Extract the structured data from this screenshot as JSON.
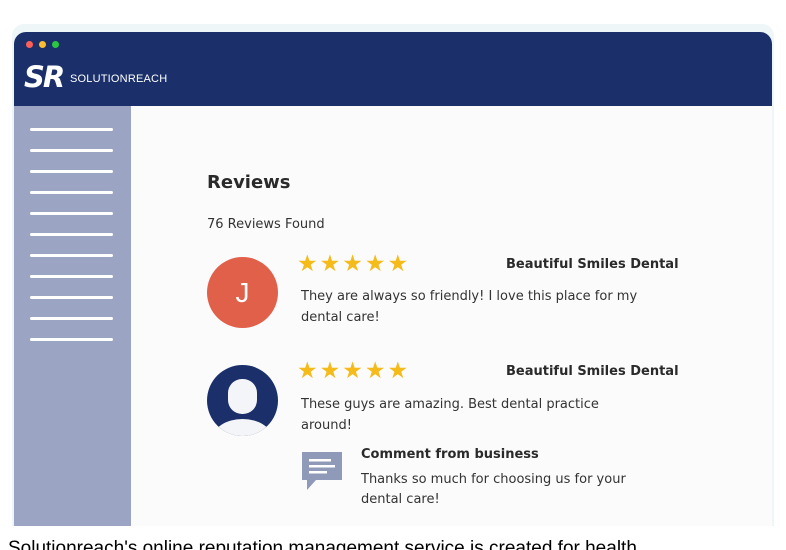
{
  "window": {
    "dots": [
      {
        "name": "close",
        "color": "#ff5f57"
      },
      {
        "name": "minimize",
        "color": "#febc2e"
      },
      {
        "name": "maximize",
        "color": "#28c840"
      }
    ]
  },
  "brand": {
    "logo_mark": "SR",
    "logo_text": "SOLUTIONREACH",
    "primary_color": "#1b306a"
  },
  "page": {
    "title": "Reviews",
    "count": "76 Reviews Found"
  },
  "reviews": [
    {
      "avatar_initial": "J",
      "avatar_color": "#e0604a",
      "rating": 5,
      "business": "Beautiful Smiles Dental",
      "text": "They are always so friendly! I love this place for my dental care!"
    },
    {
      "avatar_icon": "person-silhouette-icon",
      "avatar_color": "#1b306a",
      "rating": 5,
      "business": "Beautiful Smiles Dental",
      "text": "These guys are amazing. Best dental practice around!",
      "business_comment": {
        "heading": "Comment from business",
        "text": "Thanks so much for choosing us for your dental care!"
      }
    }
  ],
  "caption": "Solutionreach's online reputation management service is created for health"
}
